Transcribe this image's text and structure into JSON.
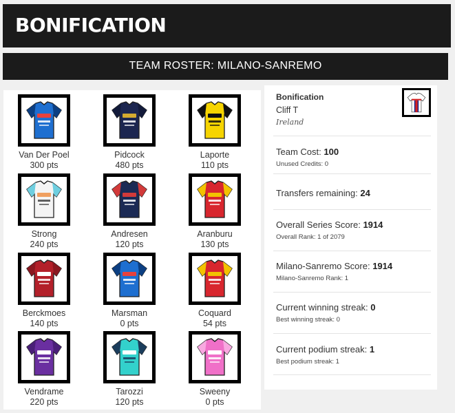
{
  "brand": {
    "title": "BONIFICATION"
  },
  "roster": {
    "title": "TEAM ROSTER: MILANO-SANREMO",
    "riders": [
      {
        "name": "Van Der Poel",
        "pts": "300 pts",
        "jersey": {
          "icon": "jersey-icon",
          "body": "#1e6fd0",
          "sleeve": "#0c3f82",
          "accent": "#e8413c",
          "text": "#ffffff"
        }
      },
      {
        "name": "Pidcock",
        "pts": "480 pts",
        "jersey": {
          "icon": "jersey-icon",
          "body": "#1c2650",
          "sleeve": "#121a3a",
          "accent": "#d4aa30",
          "text": "#ffffff"
        }
      },
      {
        "name": "Laporte",
        "pts": "110 pts",
        "jersey": {
          "icon": "jersey-icon",
          "body": "#f6d400",
          "sleeve": "#111111",
          "accent": "#111111",
          "text": "#111111"
        }
      },
      {
        "name": "Strong",
        "pts": "240 pts",
        "jersey": {
          "icon": "jersey-icon",
          "body": "#f4f4f4",
          "sleeve": "#6fcfe0",
          "accent": "#f0a060",
          "text": "#444444"
        }
      },
      {
        "name": "Andresen",
        "pts": "120 pts",
        "jersey": {
          "icon": "jersey-icon",
          "body": "#1b2a55",
          "sleeve": "#d23a3a",
          "accent": "#d23a3a",
          "text": "#ffffff"
        }
      },
      {
        "name": "Aranburu",
        "pts": "130 pts",
        "jersey": {
          "icon": "jersey-icon",
          "body": "#d8262e",
          "sleeve": "#f2c200",
          "accent": "#f2c200",
          "text": "#ffffff"
        }
      },
      {
        "name": "Berckmoes",
        "pts": "140 pts",
        "jersey": {
          "icon": "jersey-icon",
          "body": "#b3202a",
          "sleeve": "#8a1820",
          "accent": "#ffffff",
          "text": "#ffffff"
        }
      },
      {
        "name": "Marsman",
        "pts": "0 pts",
        "jersey": {
          "icon": "jersey-icon",
          "body": "#1e6fd0",
          "sleeve": "#0c3f82",
          "accent": "#e8413c",
          "text": "#ffffff"
        }
      },
      {
        "name": "Coquard",
        "pts": "54 pts",
        "jersey": {
          "icon": "jersey-icon",
          "body": "#d8262e",
          "sleeve": "#f2c200",
          "accent": "#f2c200",
          "text": "#ffffff"
        }
      },
      {
        "name": "Vendrame",
        "pts": "220 pts",
        "jersey": {
          "icon": "jersey-icon",
          "body": "#6a2fa0",
          "sleeve": "#4a1f78",
          "accent": "#ffffff",
          "text": "#ffffff"
        }
      },
      {
        "name": "Tarozzi",
        "pts": "120 pts",
        "jersey": {
          "icon": "jersey-icon",
          "body": "#33d1cc",
          "sleeve": "#1b3d5c",
          "accent": "#ffffff",
          "text": "#1b3d5c"
        }
      },
      {
        "name": "Sweeny",
        "pts": "0 pts",
        "jersey": {
          "icon": "jersey-icon",
          "body": "#f070c8",
          "sleeve": "#f8a8e0",
          "accent": "#ffffff",
          "text": "#ffffff"
        }
      }
    ]
  },
  "team": {
    "name": "Bonification",
    "manager": "Cliff T",
    "country": "Ireland",
    "jersey_icon": "team-jersey-icon"
  },
  "stats": {
    "team_cost": {
      "label": "Team Cost:",
      "value": "100",
      "sub": "Unused Credits: 0"
    },
    "transfers": {
      "label": "Transfers remaining:",
      "value": "24"
    },
    "series_score": {
      "label": "Overall Series Score:",
      "value": "1914",
      "sub": "Overall Rank: 1 of 2079"
    },
    "race_score": {
      "label": "Milano-Sanremo Score:",
      "value": "1914",
      "sub": "Milano-Sanremo Rank: 1"
    },
    "winning_streak": {
      "label": "Current winning streak:",
      "value": "0",
      "sub": "Best winning streak: 0"
    },
    "podium_streak": {
      "label": "Current podium streak:",
      "value": "1",
      "sub": "Best podium streak: 1"
    }
  }
}
